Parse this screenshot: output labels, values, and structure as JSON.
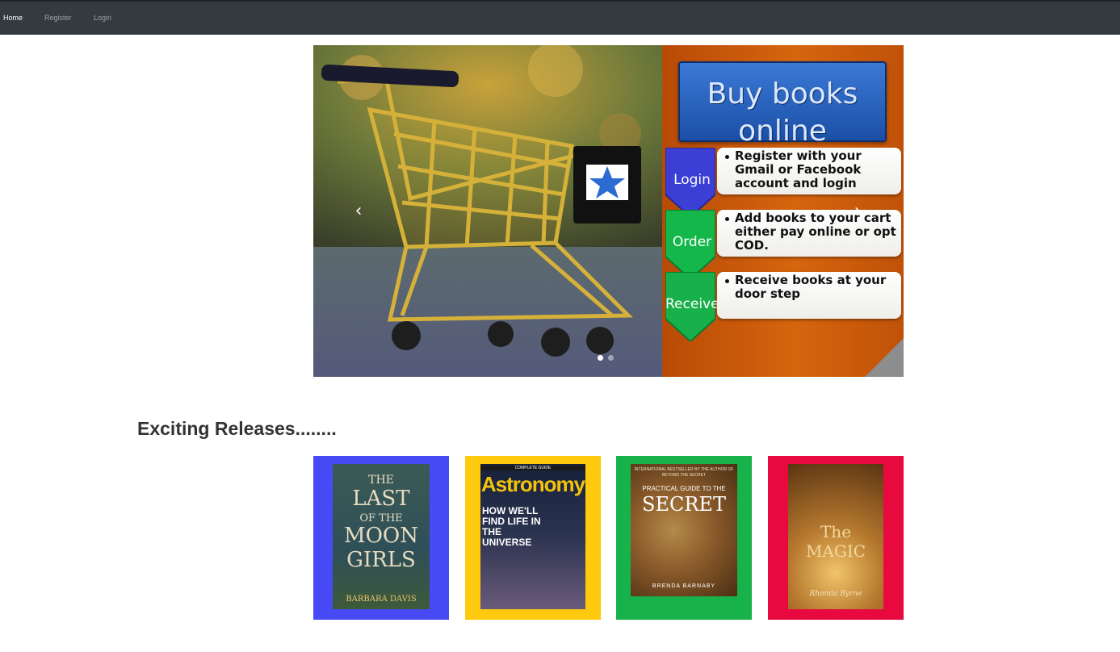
{
  "navbar": {
    "links": [
      {
        "label": "Home",
        "active": true
      },
      {
        "label": "Register",
        "active": false
      },
      {
        "label": "Login",
        "active": false
      }
    ]
  },
  "carousel": {
    "banner_title": "Buy books\nonline",
    "steps": [
      {
        "badge": "Login",
        "text": "Register with your Gmail or Facebook account and login",
        "badge_color": "#3b3fd6"
      },
      {
        "badge": "Order",
        "text": "Add books to your cart either pay online or opt COD.",
        "badge_color": "#14b84a"
      },
      {
        "badge": "Receive",
        "text": "Receive books at your door step",
        "badge_color": "#18b04a"
      }
    ],
    "prev_icon": "chevron-left-icon",
    "next_icon": "chevron-right-icon",
    "indicators": [
      {
        "active": true
      },
      {
        "active": false
      }
    ]
  },
  "section": {
    "title": "Exciting Releases........"
  },
  "books": [
    {
      "bg_color": "#474af5",
      "cover_lines": [
        "THE",
        "LAST",
        "OF THE",
        "MOON",
        "GIRLS"
      ],
      "author": "BARBARA DAVIS"
    },
    {
      "bg_color": "#ffc90e",
      "header": "COMPLETE GUIDE",
      "title": "Astronomy",
      "headline": "HOW WE'LL FIND LIFE IN THE UNIVERSE"
    },
    {
      "bg_color": "#18b24a",
      "top_line": "INTERNATIONAL BESTSELLER BY THE AUTHOR OF BEYOND THE SECRET",
      "subtitle": "PRACTICAL GUIDE TO THE",
      "title": "SECRET",
      "author": "BRENDA BARNABY"
    },
    {
      "bg_color": "#e8093f",
      "title": "The MAGIC",
      "author": "Rhonda Byrne"
    }
  ]
}
